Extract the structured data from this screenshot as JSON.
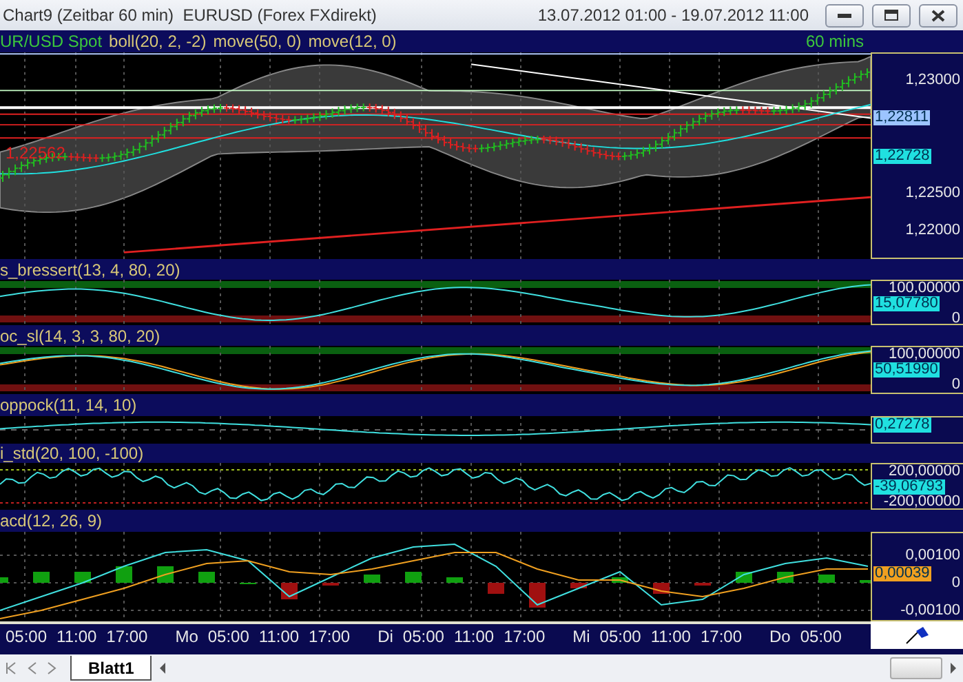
{
  "window": {
    "title": "Chart9 (Zeitbar 60 min)  EURUSD (Forex FXdirekt)",
    "date_range": "13.07.2012 01:00 - 19.07.2012 11:00"
  },
  "chart": {
    "header": [
      {
        "text": "UR/USD Spot",
        "color": "#3cc83c"
      },
      {
        "text": "boll(20, 2, -2)",
        "color": "#d8c878"
      },
      {
        "text": "move(50, 0)",
        "color": "#d8c878"
      },
      {
        "text": "move(12, 0)",
        "color": "#d8c878"
      }
    ],
    "timeframe": "60 mins",
    "price_note": "1,22562",
    "axis": [
      {
        "text": "1,23000",
        "kind": "label"
      },
      {
        "text": "1,22811",
        "kind": "tag",
        "color": "#9cc4ff"
      },
      {
        "text": "1,22728",
        "kind": "tag",
        "color": "#20e0e0"
      },
      {
        "text": "1,22500",
        "kind": "label"
      },
      {
        "text": "1,22000",
        "kind": "label"
      }
    ]
  },
  "indicators": [
    {
      "kind": "bressert",
      "title": "s_bressert(13, 4, 80, 20)",
      "axis": [
        {
          "text": "100,00000",
          "kind": "label"
        },
        {
          "text": "15,07780",
          "kind": "tag",
          "color": "#20e0e0"
        },
        {
          "text": "0",
          "kind": "label"
        }
      ]
    },
    {
      "kind": "stochastic",
      "title": "oc_sl(14, 3, 3, 80, 20)",
      "axis": [
        {
          "text": "100,00000",
          "kind": "label"
        },
        {
          "text": "50,51990",
          "kind": "tag",
          "color": "#20e0e0"
        },
        {
          "text": "0",
          "kind": "label"
        }
      ]
    },
    {
      "kind": "coppock",
      "title": "oppock(11, 14, 10)",
      "axis": [
        {
          "text": "0,27278",
          "kind": "tag",
          "color": "#20e0e0"
        }
      ]
    },
    {
      "kind": "cci",
      "title": "i_std(20, 100, -100)",
      "axis": [
        {
          "text": "200,00000",
          "kind": "label"
        },
        {
          "text": "-39,06793",
          "kind": "tag",
          "color": "#20e0e0"
        },
        {
          "text": "-200,00000",
          "kind": "label"
        }
      ]
    },
    {
      "kind": "macd",
      "title": "acd(12, 26, 9)",
      "axis": [
        {
          "text": "0,00039",
          "kind": "tag",
          "color": "#f0a020"
        }
      ],
      "chart_data": {
        "type": "line",
        "grid": true,
        "ylim": [
          -0.0014,
          0.00185
        ],
        "yticks": [
          {
            "value": 0.001,
            "label": "0,00100"
          },
          {
            "value": 0,
            "label": "0"
          },
          {
            "value": -0.001,
            "label": "-0,00100"
          }
        ],
        "series": [
          {
            "color": "#40e0e0",
            "values": [
              -0.001,
              -0.0005,
              0,
              0.0006,
              0.0011,
              0.0012,
              0.0008,
              -0.0005,
              0.0002,
              0.0009,
              0.0013,
              0.0014,
              0.0006,
              -0.0008,
              -0.0002,
              0.0004,
              -0.0008,
              -0.0006,
              0.0003,
              0.0007,
              0.0009,
              0.0006
            ]
          },
          {
            "type": "bar",
            "color": "#10a010",
            "values": [
              0.0002,
              0.0004,
              0.0004,
              0.0006,
              0.0006,
              0.0004,
              0,
              null,
              null,
              0.0003,
              0.0004,
              0.0002,
              null,
              null,
              null,
              0.0002,
              null,
              null,
              0.0004,
              0.0004,
              0.0003,
              0.0001
            ]
          },
          {
            "type": "bar",
            "color": "#a01010",
            "values": [
              null,
              null,
              null,
              null,
              null,
              null,
              null,
              -0.0006,
              -0.0001,
              null,
              null,
              null,
              -0.0004,
              -0.0009,
              -0.0002,
              null,
              -0.0004,
              -0.0001,
              null,
              null,
              null,
              null
            ]
          },
          {
            "color": "#f0a020",
            "values": [
              -0.0013,
              -0.001,
              -0.0006,
              -0.0002,
              0.0003,
              0.0007,
              0.0008,
              0.0004,
              0.0003,
              0.0005,
              0.0008,
              0.0011,
              0.0011,
              0.0005,
              0.0001,
              0.0001,
              -0.0003,
              -0.0005,
              -0.0002,
              0.0002,
              0.0005,
              0.0005
            ]
          }
        ]
      }
    }
  ],
  "time_axis": [
    {
      "text": "05:00",
      "kind": "time"
    },
    {
      "text": "11:00",
      "kind": "time"
    },
    {
      "text": "17:00",
      "kind": "time"
    },
    {
      "text": "Mo",
      "kind": "day"
    },
    {
      "text": "05:00",
      "kind": "time"
    },
    {
      "text": "11:00",
      "kind": "time"
    },
    {
      "text": "17:00",
      "kind": "time"
    },
    {
      "text": "Di",
      "kind": "day"
    },
    {
      "text": "05:00",
      "kind": "time"
    },
    {
      "text": "11:00",
      "kind": "time"
    },
    {
      "text": "17:00",
      "kind": "time"
    },
    {
      "text": "Mi",
      "kind": "day"
    },
    {
      "text": "05:00",
      "kind": "time"
    },
    {
      "text": "11:00",
      "kind": "time"
    },
    {
      "text": "17:00",
      "kind": "time"
    },
    {
      "text": "Do",
      "kind": "day"
    },
    {
      "text": "05:00",
      "kind": "time"
    }
  ],
  "tabs": [
    {
      "label": "Blatt1",
      "selected": true
    }
  ]
}
